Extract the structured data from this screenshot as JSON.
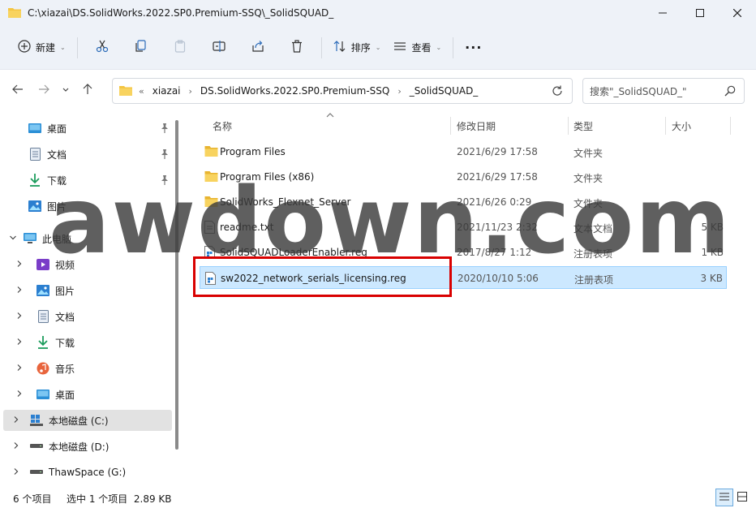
{
  "window": {
    "title": "C:\\xiazai\\DS.SolidWorks.2022.SP0.Premium-SSQ\\_SolidSQUAD_"
  },
  "toolbar": {
    "new_label": "新建",
    "sort_label": "排序",
    "view_label": "查看",
    "more": "···"
  },
  "address": {
    "overflow": "«",
    "crumbs": [
      "xiazai",
      "DS.SolidWorks.2022.SP0.Premium-SSQ",
      "_SolidSQUAD_"
    ],
    "separator": "›"
  },
  "search": {
    "placeholder": "搜索\"_SolidSQUAD_\""
  },
  "sidebar": {
    "items": [
      {
        "label": "桌面"
      },
      {
        "label": "文档"
      },
      {
        "label": "下载"
      },
      {
        "label": "图片"
      },
      {
        "label": "此电脑"
      },
      {
        "label": "视频"
      },
      {
        "label": "图片"
      },
      {
        "label": "文档"
      },
      {
        "label": "下载"
      },
      {
        "label": "音乐"
      },
      {
        "label": "桌面"
      },
      {
        "label": "本地磁盘 (C:)"
      },
      {
        "label": "本地磁盘 (D:)"
      },
      {
        "label": "ThawSpace (G:)"
      }
    ]
  },
  "columns": {
    "name": "名称",
    "date": "修改日期",
    "type": "类型",
    "size": "大小"
  },
  "files": [
    {
      "name": "Program Files",
      "date": "2021/6/29 17:58",
      "type": "文件夹",
      "size": ""
    },
    {
      "name": "Program Files (x86)",
      "date": "2021/6/29 17:58",
      "type": "文件夹",
      "size": ""
    },
    {
      "name": "SolidWorks_Flexnet_Server",
      "date": "2021/6/26 0:29",
      "type": "文件夹",
      "size": ""
    },
    {
      "name": "readme.txt",
      "date": "2021/11/23 2:32",
      "type": "文本文档",
      "size": "5 KB"
    },
    {
      "name": "SolidSQUADLoaderEnabler.reg",
      "date": "2017/8/27 1:12",
      "type": "注册表项",
      "size": "1 KB"
    },
    {
      "name": "sw2022_network_serials_licensing.reg",
      "date": "2020/10/10 5:06",
      "type": "注册表项",
      "size": "3 KB"
    }
  ],
  "watermark": "awdown.com",
  "status": {
    "count": "6 个项目",
    "selection": "选中 1 个项目  2.89 KB"
  },
  "colors": {
    "selection": "#cce8ff",
    "highlight": "#d90000",
    "folder": "#f4c542"
  }
}
